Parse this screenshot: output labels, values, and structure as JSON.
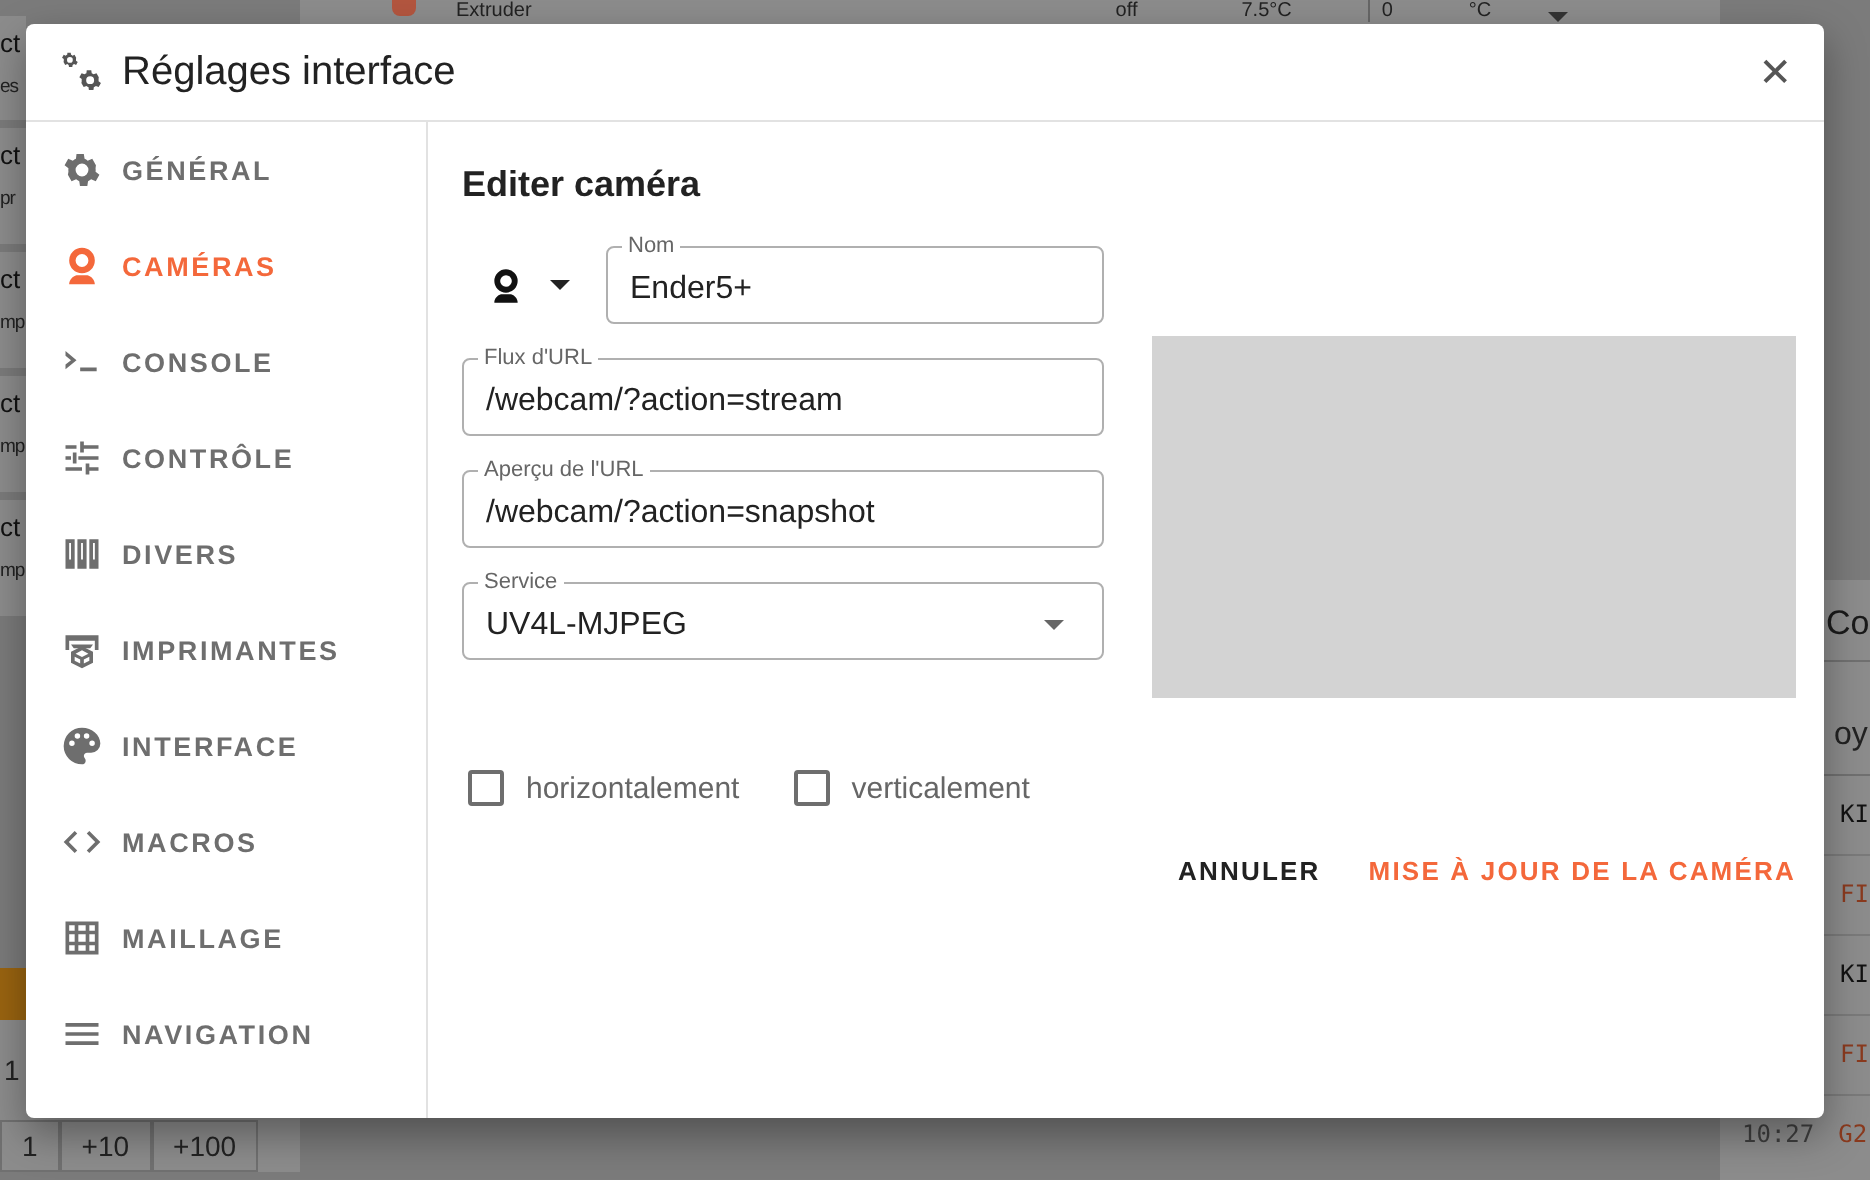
{
  "background": {
    "heater_row": {
      "name": "Extruder",
      "state": "off",
      "temperature": "7.5°C",
      "target": "0",
      "unit": "°C"
    },
    "left_fragments": [
      [
        "ct",
        "es"
      ],
      [
        "ct",
        "pr"
      ],
      [
        "ct",
        "mp"
      ],
      [
        "ct",
        "mp"
      ],
      [
        "ct",
        "mp"
      ]
    ],
    "jog_rows": [
      [
        "1"
      ],
      [
        "1",
        "+10",
        "+100"
      ]
    ],
    "console": {
      "title": "Co",
      "field": "oy",
      "lines": [
        {
          "text": "KI",
          "kind": "response"
        },
        {
          "text": "FI",
          "kind": "error"
        },
        {
          "text": "KI",
          "kind": "response"
        },
        {
          "text": "FI",
          "kind": "error"
        }
      ],
      "last": {
        "time": "10:27",
        "text": "G2"
      }
    }
  },
  "dialog": {
    "title": "Réglages interface",
    "close": "✕",
    "nav": [
      {
        "label": "GÉNÉRAL",
        "selected": false
      },
      {
        "label": "CAMÉRAS",
        "selected": true
      },
      {
        "label": "CONSOLE",
        "selected": false
      },
      {
        "label": "CONTRÔLE",
        "selected": false
      },
      {
        "label": "DIVERS",
        "selected": false
      },
      {
        "label": "IMPRIMANTES",
        "selected": false
      },
      {
        "label": "INTERFACE",
        "selected": false
      },
      {
        "label": "MACROS",
        "selected": false
      },
      {
        "label": "MAILLAGE",
        "selected": false
      },
      {
        "label": "NAVIGATION",
        "selected": false
      }
    ],
    "heading": "Editer caméra",
    "fields": [
      {
        "label": "Nom",
        "value": "Ender5+",
        "kind": "text"
      },
      {
        "label": "Flux d'URL",
        "value": "/webcam/?action=stream",
        "kind": "text"
      },
      {
        "label": "Aperçu de l'URL",
        "value": "/webcam/?action=snapshot",
        "kind": "text"
      },
      {
        "label": "Service",
        "value": "UV4L-MJPEG",
        "kind": "select"
      }
    ],
    "checkboxes": [
      {
        "label": "horizontalement",
        "checked": false
      },
      {
        "label": "verticalement",
        "checked": false
      }
    ],
    "buttons": [
      {
        "label": "ANNULER",
        "kind": "plain"
      },
      {
        "label": "MISE À JOUR DE LA CAMÉRA",
        "kind": "primary"
      }
    ]
  }
}
